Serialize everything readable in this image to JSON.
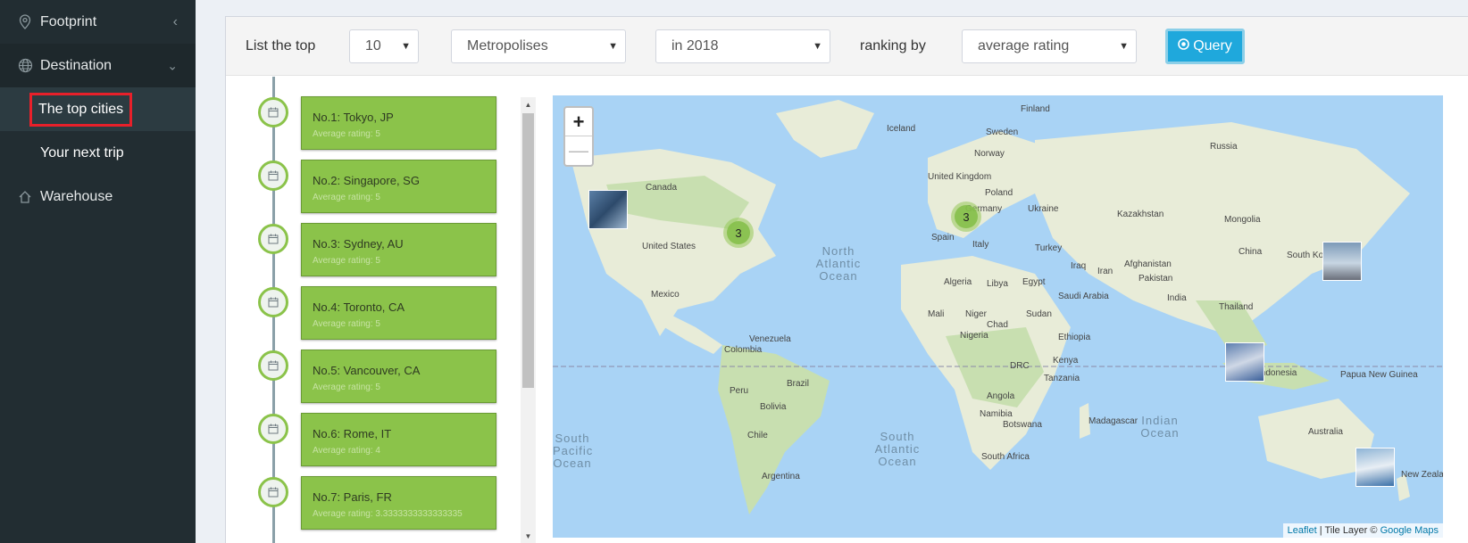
{
  "sidebar": {
    "items": [
      {
        "label": "Footprint",
        "icon": "map-pin-icon",
        "caret": "‹"
      },
      {
        "label": "Destination",
        "icon": "globe-icon",
        "caret": "⌄"
      },
      {
        "label": "Warehouse",
        "icon": "home-icon"
      }
    ],
    "subitems": [
      {
        "label": "The top cities"
      },
      {
        "label": "Your next trip"
      }
    ]
  },
  "query": {
    "prefix": "List the top",
    "count": "10",
    "category": "Metropolises",
    "year": "in 2018",
    "ranking_label": "ranking by",
    "ranking": "average rating",
    "button_label": "Query",
    "accent": "#1fa8dc"
  },
  "timeline": [
    {
      "title": "No.1: Tokyo, JP",
      "subtitle": "Average rating: 5"
    },
    {
      "title": "No.2: Singapore, SG",
      "subtitle": "Average rating: 5"
    },
    {
      "title": "No.3: Sydney, AU",
      "subtitle": "Average rating: 5"
    },
    {
      "title": "No.4: Toronto, CA",
      "subtitle": "Average rating: 5"
    },
    {
      "title": "No.5: Vancouver, CA",
      "subtitle": "Average rating: 5"
    },
    {
      "title": "No.6: Rome, IT",
      "subtitle": "Average rating: 4"
    },
    {
      "title": "No.7: Paris, FR",
      "subtitle": "Average rating: 3.3333333333333335"
    }
  ],
  "map": {
    "zoom_in": "+",
    "zoom_out": "—",
    "clusters": [
      {
        "count": "3"
      },
      {
        "count": "3"
      }
    ],
    "labels": [
      "Finland",
      "Iceland",
      "Sweden",
      "Norway",
      "Russia",
      "Canada",
      "United Kingdom",
      "Poland",
      "Germany",
      "Ukraine",
      "Kazakhstan",
      "Mongolia",
      "United States",
      "Spain",
      "Italy",
      "Turkey",
      "China",
      "South Korea",
      "Afghanistan",
      "Iran",
      "Pakistan",
      "Iraq",
      "Algeria",
      "Libya",
      "Egypt",
      "Saudi Arabia",
      "India",
      "Mexico",
      "Mali",
      "Niger",
      "Chad",
      "Sudan",
      "Thailand",
      "Nigeria",
      "Ethiopia",
      "Venezuela",
      "Colombia",
      "Kenya",
      "DRC",
      "Indonesia",
      "Papua New Guinea",
      "Tanzania",
      "Brazil",
      "Peru",
      "Bolivia",
      "Angola",
      "Namibia",
      "Botswana",
      "Madagascar",
      "Australia",
      "Chile",
      "South Africa",
      "Argentina",
      "New Zealand"
    ],
    "oceans": [
      "North Atlantic Ocean",
      "South Atlantic Ocean",
      "Indian Ocean",
      "South Pacific Ocean"
    ],
    "attribution_leaflet": "Leaflet",
    "attribution_sep": " | Tile Layer © ",
    "attribution_google": "Google Maps"
  }
}
